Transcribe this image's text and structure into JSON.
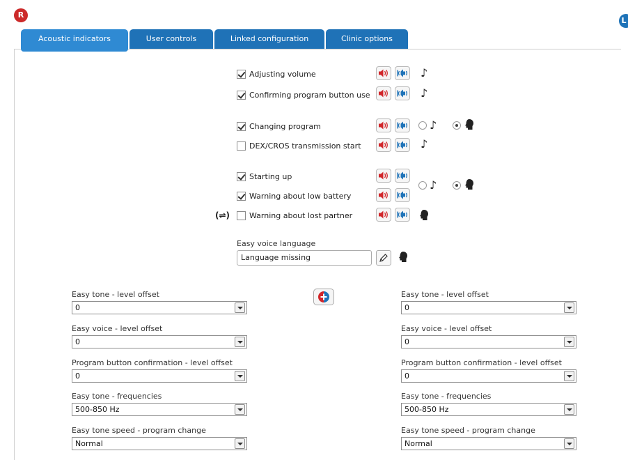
{
  "badges": {
    "left": "R",
    "right": "L"
  },
  "tabs": [
    {
      "label": "Acoustic indicators",
      "active": true
    },
    {
      "label": "User controls",
      "active": false
    },
    {
      "label": "Linked configuration",
      "active": false
    },
    {
      "label": "Clinic options",
      "active": false
    }
  ],
  "indicators": [
    {
      "label": "Adjusting volume",
      "checked": true
    },
    {
      "label": "Confirming program button use",
      "checked": true
    },
    {
      "label": "Changing program",
      "checked": true
    },
    {
      "label": "DEX/CROS transmission start",
      "checked": false
    },
    {
      "label": "Starting up",
      "checked": true
    },
    {
      "label": "Warning about low battery",
      "checked": true
    },
    {
      "label": "Warning about lost partner",
      "checked": false
    }
  ],
  "partner_icon_text": "(⇌)",
  "voice_language": {
    "label": "Easy voice language",
    "value": "Language missing"
  },
  "icons": {
    "speaker_red": "speaker-red-icon",
    "speaker_blue": "speaker-blue-icon",
    "tone": "music-note-icon",
    "voice": "voice-head-icon",
    "edit": "pencil-icon",
    "link": "link-sides-icon",
    "tone_glyph": "♪"
  },
  "colors": {
    "tab": "#1f72b7",
    "tab_active": "#2f8ad3",
    "speaker_red": "#d1262a",
    "speaker_blue": "#1e73b8"
  },
  "left_settings": [
    {
      "label": "Easy tone - level offset",
      "value": "0"
    },
    {
      "label": "Easy voice - level offset",
      "value": "0"
    },
    {
      "label": "Program button confirmation - level offset",
      "value": "0"
    },
    {
      "label": "Easy tone - frequencies",
      "value": "500-850 Hz"
    },
    {
      "label": "Easy tone speed - program change",
      "value": "Normal"
    }
  ],
  "right_settings": [
    {
      "label": "Easy tone - level offset",
      "value": "0"
    },
    {
      "label": "Easy voice - level offset",
      "value": "0"
    },
    {
      "label": "Program button confirmation - level offset",
      "value": "0"
    },
    {
      "label": "Easy tone - frequencies",
      "value": "500-850 Hz"
    },
    {
      "label": "Easy tone speed - program change",
      "value": "Normal"
    }
  ]
}
